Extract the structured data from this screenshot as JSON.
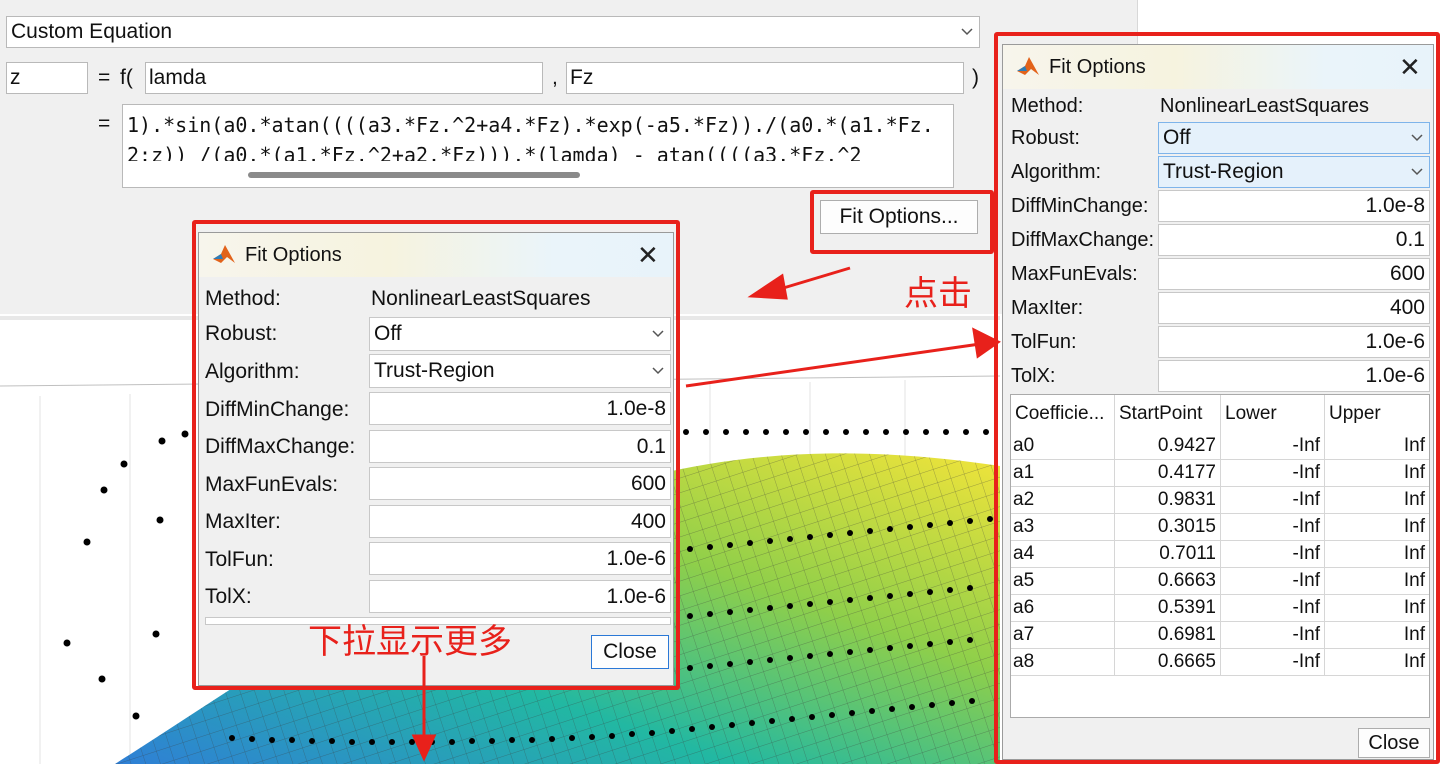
{
  "editor": {
    "fit_type": "Custom Equation",
    "dependent_var": "z",
    "eq_sign": "=",
    "func_open": "f(",
    "indep_var1": "lamda",
    "comma": ",",
    "indep_var2": "Fz",
    "func_close": ")",
    "eq_sign2": "=",
    "equation_line1": "1).*sin(a0.*atan((((a3.*Fz.^2+a4.*Fz).*exp(-a5.*Fz))./(a0.*(a1.*Fz.",
    "equation_line2": "2:z)) /(a0.*(a1.*Fz.^2+a2.*Fz))).*(lamda) - atan((((a3.*Fz.^2",
    "fit_options_button": "Fit Options..."
  },
  "annotations": {
    "click_label": "点击",
    "scroll_label": "下拉显示更多",
    "accent_color": "#e8211b"
  },
  "dialog_small": {
    "title": "Fit Options",
    "method_label": "Method:",
    "method_value": "NonlinearLeastSquares",
    "robust_label": "Robust:",
    "robust_value": "Off",
    "algorithm_label": "Algorithm:",
    "algorithm_value": "Trust-Region",
    "diffmin_label": "DiffMinChange:",
    "diffmin_value": "1.0e-8",
    "diffmax_label": "DiffMaxChange:",
    "diffmax_value": "0.1",
    "maxfun_label": "MaxFunEvals:",
    "maxfun_value": "600",
    "maxiter_label": "MaxIter:",
    "maxiter_value": "400",
    "tolfun_label": "TolFun:",
    "tolfun_value": "1.0e-6",
    "tolx_label": "TolX:",
    "tolx_value": "1.0e-6",
    "close_label": "Close"
  },
  "dialog_large": {
    "title": "Fit Options",
    "method_label": "Method:",
    "method_value": "NonlinearLeastSquares",
    "robust_label": "Robust:",
    "robust_value": "Off",
    "algorithm_label": "Algorithm:",
    "algorithm_value": "Trust-Region",
    "diffmin_label": "DiffMinChange:",
    "diffmin_value": "1.0e-8",
    "diffmax_label": "DiffMaxChange:",
    "diffmax_value": "0.1",
    "maxfun_label": "MaxFunEvals:",
    "maxfun_value": "600",
    "maxiter_label": "MaxIter:",
    "maxiter_value": "400",
    "tolfun_label": "TolFun:",
    "tolfun_value": "1.0e-6",
    "tolx_label": "TolX:",
    "tolx_value": "1.0e-6",
    "table": {
      "headers": [
        "Coefficie...",
        "StartPoint",
        "Lower",
        "Upper"
      ],
      "rows": [
        [
          "a0",
          "0.9427",
          "-Inf",
          "Inf"
        ],
        [
          "a1",
          "0.4177",
          "-Inf",
          "Inf"
        ],
        [
          "a2",
          "0.9831",
          "-Inf",
          "Inf"
        ],
        [
          "a3",
          "0.3015",
          "-Inf",
          "Inf"
        ],
        [
          "a4",
          "0.7011",
          "-Inf",
          "Inf"
        ],
        [
          "a5",
          "0.6663",
          "-Inf",
          "Inf"
        ],
        [
          "a6",
          "0.5391",
          "-Inf",
          "Inf"
        ],
        [
          "a7",
          "0.6981",
          "-Inf",
          "Inf"
        ],
        [
          "a8",
          "0.6665",
          "-Inf",
          "Inf"
        ]
      ]
    },
    "close_label": "Close"
  }
}
